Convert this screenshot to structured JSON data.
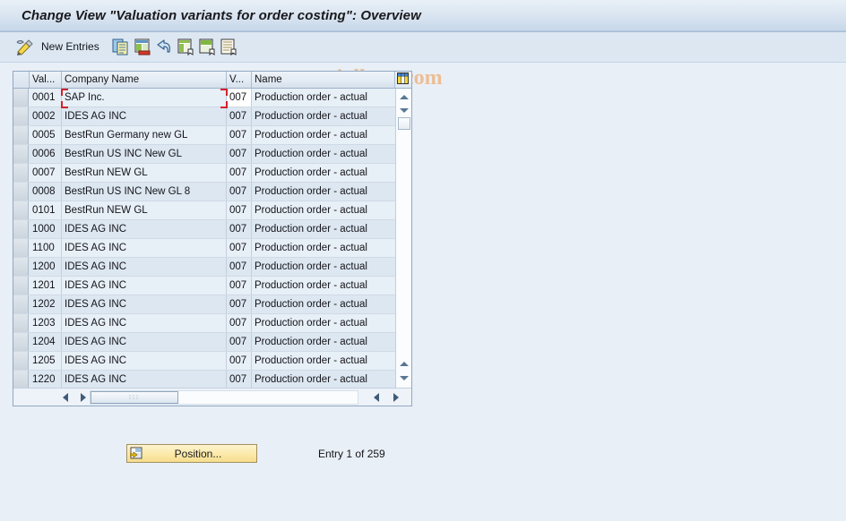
{
  "window": {
    "title": "Change View \"Valuation variants for order costing\": Overview"
  },
  "toolbar": {
    "edit_icon": "pencil-icon",
    "new_entries_label": "New Entries",
    "buttons": [
      {
        "icon": "copy-icon",
        "name": "copy-as-button"
      },
      {
        "icon": "delete-row-icon",
        "name": "delete-button"
      },
      {
        "icon": "undo-icon",
        "name": "undo-button"
      },
      {
        "icon": "select-all-icon",
        "name": "select-all-button"
      },
      {
        "icon": "deselect-all-icon",
        "name": "deselect-all-button"
      },
      {
        "icon": "details-icon",
        "name": "details-button"
      }
    ]
  },
  "watermark": {
    "text": "www.tutorialkart.com",
    "color": "#ecbe96"
  },
  "table": {
    "columns": [
      {
        "key": "valuation_area",
        "label": "Val..."
      },
      {
        "key": "company_name",
        "label": "Company Name"
      },
      {
        "key": "variant",
        "label": "V..."
      },
      {
        "key": "name",
        "label": "Name"
      }
    ],
    "settings_icon": "table-settings-icon",
    "rows": [
      {
        "valuation_area": "0001",
        "company_name": "SAP Inc.",
        "variant": "007",
        "name": "Production order - actual"
      },
      {
        "valuation_area": "0002",
        "company_name": "IDES AG INC",
        "variant": "007",
        "name": "Production order - actual"
      },
      {
        "valuation_area": "0005",
        "company_name": "BestRun Germany new GL",
        "variant": "007",
        "name": "Production order - actual"
      },
      {
        "valuation_area": "0006",
        "company_name": "BestRun US INC New GL",
        "variant": "007",
        "name": "Production order - actual"
      },
      {
        "valuation_area": "0007",
        "company_name": "BestRun NEW GL",
        "variant": "007",
        "name": "Production order - actual"
      },
      {
        "valuation_area": "0008",
        "company_name": "BestRun US INC New GL 8",
        "variant": "007",
        "name": "Production order - actual"
      },
      {
        "valuation_area": "0101",
        "company_name": "BestRun NEW GL",
        "variant": "007",
        "name": "Production order - actual"
      },
      {
        "valuation_area": "1000",
        "company_name": "IDES AG INC",
        "variant": "007",
        "name": "Production order - actual"
      },
      {
        "valuation_area": "1100",
        "company_name": "IDES AG INC",
        "variant": "007",
        "name": "Production order - actual"
      },
      {
        "valuation_area": "1200",
        "company_name": "IDES AG INC",
        "variant": "007",
        "name": "Production order - actual"
      },
      {
        "valuation_area": "1201",
        "company_name": "IDES AG INC",
        "variant": "007",
        "name": "Production order - actual"
      },
      {
        "valuation_area": "1202",
        "company_name": "IDES AG INC",
        "variant": "007",
        "name": "Production order - actual"
      },
      {
        "valuation_area": "1203",
        "company_name": "IDES AG INC",
        "variant": "007",
        "name": "Production order - actual"
      },
      {
        "valuation_area": "1204",
        "company_name": "IDES AG INC",
        "variant": "007",
        "name": "Production order - actual"
      },
      {
        "valuation_area": "1205",
        "company_name": "IDES AG INC",
        "variant": "007",
        "name": "Production order - actual"
      },
      {
        "valuation_area": "1220",
        "company_name": "IDES AG INC",
        "variant": "007",
        "name": "Production order - actual"
      }
    ]
  },
  "footer": {
    "position_button_label": "Position...",
    "position_button_icon": "position-icon",
    "entry_status": "Entry 1 of 259"
  }
}
